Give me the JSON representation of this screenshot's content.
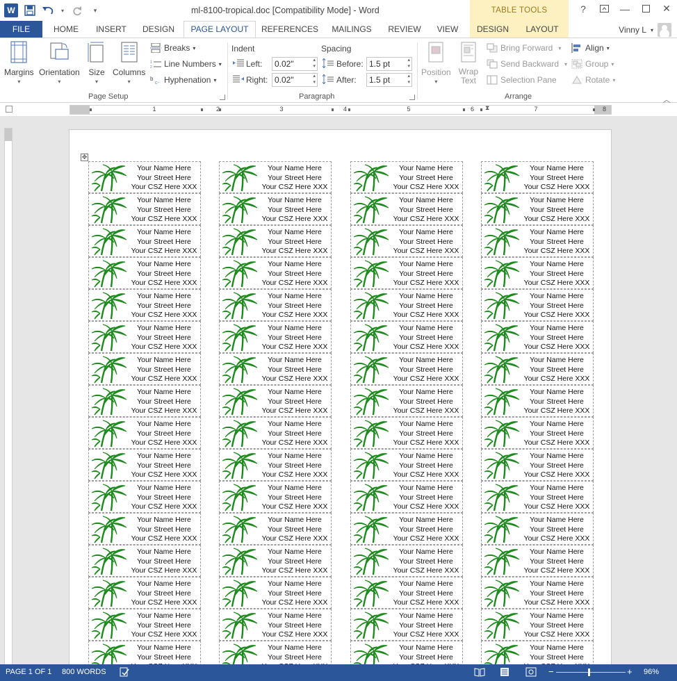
{
  "app": {
    "logo_letter": "W",
    "document_title": "ml-8100-tropical.doc [Compatibility Mode] - Word",
    "contextual_header": "TABLE TOOLS",
    "user_name": "Vinny L",
    "brand_color": "#2b579a",
    "context_color": "#fdf1c2"
  },
  "tabs": [
    {
      "label": "FILE"
    },
    {
      "label": "HOME"
    },
    {
      "label": "INSERT"
    },
    {
      "label": "DESIGN"
    },
    {
      "label": "PAGE LAYOUT"
    },
    {
      "label": "REFERENCES"
    },
    {
      "label": "MAILINGS"
    },
    {
      "label": "REVIEW"
    },
    {
      "label": "VIEW"
    },
    {
      "label": "DESIGN"
    },
    {
      "label": "LAYOUT"
    }
  ],
  "ribbon": {
    "page_setup": {
      "margins": "Margins",
      "orientation": "Orientation",
      "size": "Size",
      "columns": "Columns",
      "breaks": "Breaks",
      "line_numbers": "Line Numbers",
      "hyphenation": "Hyphenation",
      "group_label": "Page Setup"
    },
    "paragraph": {
      "indent_label": "Indent",
      "spacing_label": "Spacing",
      "left_label": "Left:",
      "right_label": "Right:",
      "before_label": "Before:",
      "after_label": "After:",
      "indent_left": "0.02\"",
      "indent_right": "0.02\"",
      "spacing_before": "1.5 pt",
      "spacing_after": "1.5 pt",
      "group_label": "Paragraph"
    },
    "arrange": {
      "position": "Position",
      "wrap_text_1": "Wrap",
      "wrap_text_2": "Text",
      "bring_forward": "Bring Forward",
      "send_backward": "Send Backward",
      "selection_pane": "Selection Pane",
      "align": "Align",
      "group": "Group",
      "rotate": "Rotate",
      "group_label": "Arrange"
    }
  },
  "ruler": {
    "numbers": [
      "1",
      "2",
      "3",
      "4",
      "5",
      "6",
      "7",
      "8"
    ]
  },
  "labels": {
    "line1": "Your Name Here",
    "line2": "Your Street Here",
    "line3": "Your CSZ Here XXX"
  },
  "statusbar": {
    "page": "PAGE 1 OF 1",
    "words": "800 WORDS",
    "zoom": "96%",
    "zoom_minus": "−",
    "zoom_plus": "+"
  }
}
